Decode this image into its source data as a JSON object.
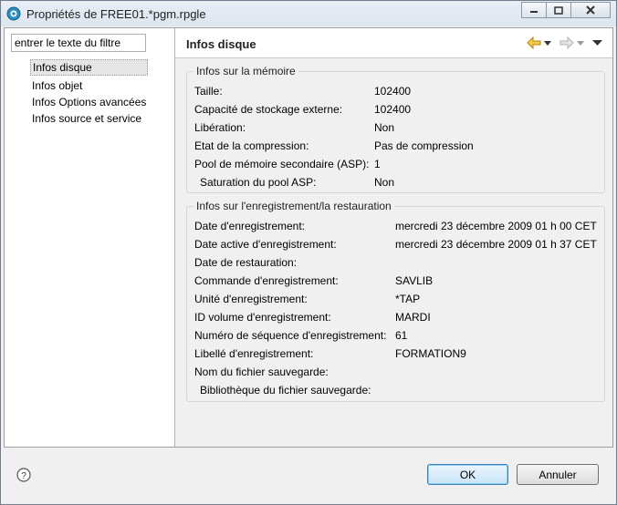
{
  "window": {
    "title": "Propriétés de FREE01.*pgm.rpgle"
  },
  "filter": {
    "value": "entrer le texte du filtre"
  },
  "nav": {
    "items": [
      {
        "label": "Infos disque"
      },
      {
        "label": "Infos objet"
      },
      {
        "label": "Infos Options avancées"
      },
      {
        "label": "Infos source et service"
      }
    ]
  },
  "page": {
    "title": "Infos disque"
  },
  "memory": {
    "title": "Infos sur la mémoire",
    "rows": [
      {
        "label": "Taille:",
        "value": "102400"
      },
      {
        "label": "Capacité de stockage externe:",
        "value": "102400"
      },
      {
        "label": "Libération:",
        "value": "Non"
      },
      {
        "label": "Etat de la compression:",
        "value": "Pas de compression"
      },
      {
        "label": "Pool de mémoire secondaire (ASP):",
        "value": "1"
      },
      {
        "label": "  Saturation du pool ASP:",
        "value": "Non"
      }
    ]
  },
  "save": {
    "title": "Infos sur l'enregistrement/la restauration",
    "rows": [
      {
        "label": "Date d'enregistrement:",
        "value": "mercredi 23 décembre 2009 01 h 00 CET"
      },
      {
        "label": "Date active d'enregistrement:",
        "value": "mercredi 23 décembre 2009 01 h 37 CET"
      },
      {
        "label": "Date de restauration:",
        "value": ""
      },
      {
        "label": "Commande d'enregistrement:",
        "value": "SAVLIB"
      },
      {
        "label": "Unité d'enregistrement:",
        "value": "*TAP"
      },
      {
        "label": "ID volume d'enregistrement:",
        "value": "MARDI"
      },
      {
        "label": "Numéro de séquence d'enregistrement:",
        "value": "61"
      },
      {
        "label": "Libellé d'enregistrement:",
        "value": "FORMATION9"
      },
      {
        "label": "Nom du fichier sauvegarde:",
        "value": ""
      },
      {
        "label": "  Bibliothèque du fichier sauvegarde:",
        "value": ""
      }
    ]
  },
  "buttons": {
    "ok": "OK",
    "cancel": "Annuler"
  }
}
